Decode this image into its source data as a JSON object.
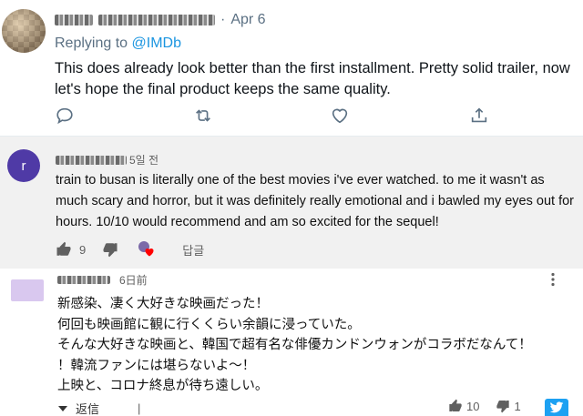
{
  "tweet": {
    "date": "Apr 6",
    "replying_prefix": "Replying to ",
    "replying_to": "@IMDb",
    "text": "This does already look better than the first installment. Pretty solid trailer, now let's hope the final product keeps the same quality.",
    "icons": [
      "reply-icon",
      "retweet-icon",
      "like-icon",
      "share-icon"
    ]
  },
  "comment1": {
    "avatar_letter": "r",
    "time": "5일 전",
    "text": "train to busan is literally one of the best movies i've ever watched. to me it wasn't as much scary and horror, but it was definitely really emotional and i bawled my eyes out for hours. 10/10 would recommend and am so excited for the sequel!",
    "likes": "9",
    "reply_label": "답글",
    "accent": "#4f3aa6",
    "heart_color": "#ff0000"
  },
  "comment2": {
    "time": "6日前",
    "text": "新感染、凄く大好きな映画だった！\n何回も映画館に観に行くくらい余韻に浸っていた。\nそんな大好きな映画と、韓国で超有名な俳優カンドンウォンがコラボだなんて！\n！韓流ファンには堪らないよ〜！\n上映と、コロナ終息が待ち遠しい。",
    "reply_label": "返信",
    "likes": "10",
    "dislikes": "1"
  },
  "brand_colors": {
    "twitter_blue": "#1da1f2",
    "link_blue": "#1b95e0"
  }
}
